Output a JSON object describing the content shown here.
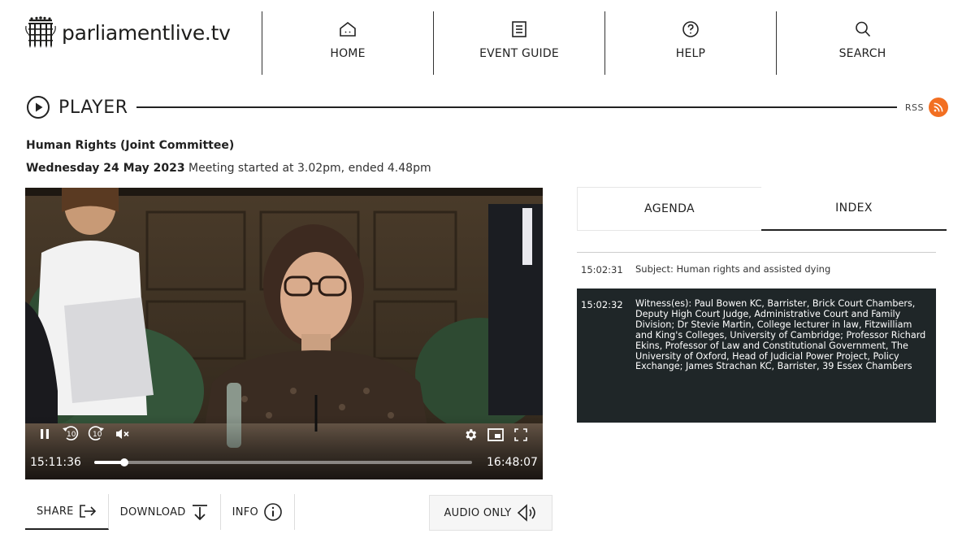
{
  "header": {
    "logo_text": "parliamentlive.tv",
    "nav": [
      {
        "label": "HOME",
        "icon": "home-icon"
      },
      {
        "label": "EVENT GUIDE",
        "icon": "event-guide-icon"
      },
      {
        "label": "HELP",
        "icon": "help-icon"
      },
      {
        "label": "SEARCH",
        "icon": "search-icon"
      }
    ]
  },
  "player": {
    "title": "PLAYER",
    "rss_label": "RSS",
    "committee": "Human Rights (Joint Committee)",
    "date": "Wednesday 24 May 2023",
    "meeting_info": " Meeting started at 3.02pm, ended 4.48pm"
  },
  "video": {
    "current_time": "15:11:36",
    "end_time": "16:48:07",
    "progress_fraction": 0.08,
    "rewind_label": "10",
    "forward_label": "10"
  },
  "actions": {
    "share": "SHARE",
    "download": "DOWNLOAD",
    "info": "INFO",
    "audio_only": "AUDIO ONLY"
  },
  "tabs": {
    "agenda": "AGENDA",
    "index": "INDEX",
    "active": "index"
  },
  "index_entries": [
    {
      "time": "15:02:31",
      "text": "Subject: Human rights and assisted dying",
      "selected": false
    },
    {
      "time": "15:02:32",
      "text": "Witness(es): Paul Bowen KC, Barrister, Brick Court Chambers, Deputy High Court Judge, Administrative Court and Family Division; Dr Stevie Martin, College lecturer in law, Fitzwilliam and King's Colleges, University of Cambridge; Professor Richard Ekins, Professor of Law and Constitutional Government, The University of Oxford, Head of Judicial Power Project, Policy Exchange; James Strachan KC, Barrister, 39 Essex Chambers",
      "selected": true
    }
  ],
  "colors": {
    "rss": "#f26f22",
    "selected_row": "#1f2628"
  }
}
